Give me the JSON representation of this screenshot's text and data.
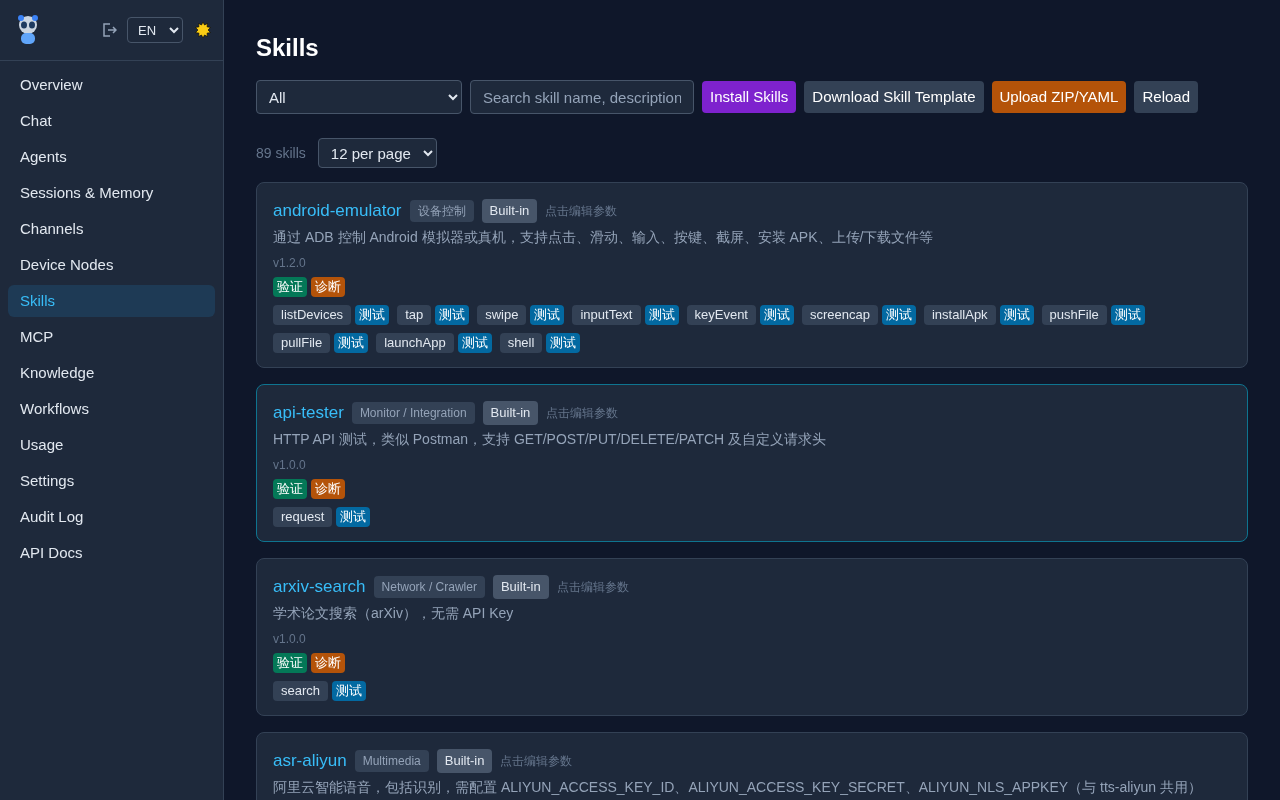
{
  "sidebar": {
    "language": "EN",
    "items": [
      {
        "label": "Overview",
        "selected": false
      },
      {
        "label": "Chat",
        "selected": false
      },
      {
        "label": "Agents",
        "selected": false
      },
      {
        "label": "Sessions & Memory",
        "selected": false
      },
      {
        "label": "Channels",
        "selected": false
      },
      {
        "label": "Device Nodes",
        "selected": false
      },
      {
        "label": "Skills",
        "selected": true
      },
      {
        "label": "MCP",
        "selected": false
      },
      {
        "label": "Knowledge",
        "selected": false
      },
      {
        "label": "Workflows",
        "selected": false
      },
      {
        "label": "Usage",
        "selected": false
      },
      {
        "label": "Settings",
        "selected": false
      },
      {
        "label": "Audit Log",
        "selected": false
      },
      {
        "label": "API Docs",
        "selected": false
      }
    ]
  },
  "page": {
    "title": "Skills",
    "filter": {
      "value": "All"
    },
    "search": {
      "placeholder": "Search skill name, description"
    },
    "buttons": [
      {
        "label": "Install Skills",
        "kind": "primary"
      },
      {
        "label": "Download Skill Template",
        "kind": "secondary"
      },
      {
        "label": "Upload ZIP/YAML",
        "kind": "warning"
      },
      {
        "label": "Reload",
        "kind": "secondary"
      }
    ],
    "count": "89 skills",
    "page_size": "12 per page"
  },
  "skills": [
    {
      "name": "android-emulator",
      "category": "设备控制",
      "source": "Built-in",
      "hint": "点击编辑参数",
      "highlighted": false,
      "description": "通过 ADB 控制 Android 模拟器或真机，支持点击、滑动、输入、按键、截屏、安装 APK、上传/下载文件等",
      "version": "v1.2.0",
      "badges": [
        {
          "label": "验证",
          "kind": "verify"
        },
        {
          "label": "诊断",
          "kind": "diagnose"
        }
      ],
      "tools": [
        {
          "name": "listDevices",
          "test": "测试"
        },
        {
          "name": "tap",
          "test": "测试"
        },
        {
          "name": "swipe",
          "test": "测试"
        },
        {
          "name": "inputText",
          "test": "测试"
        },
        {
          "name": "keyEvent",
          "test": "测试"
        },
        {
          "name": "screencap",
          "test": "测试"
        },
        {
          "name": "installApk",
          "test": "测试"
        },
        {
          "name": "pushFile",
          "test": "测试"
        },
        {
          "name": "pullFile",
          "test": "测试"
        },
        {
          "name": "launchApp",
          "test": "测试"
        },
        {
          "name": "shell",
          "test": "测试"
        }
      ]
    },
    {
      "name": "api-tester",
      "category": "Monitor / Integration",
      "source": "Built-in",
      "hint": "点击编辑参数",
      "highlighted": true,
      "description": "HTTP API 测试，类似 Postman，支持 GET/POST/PUT/DELETE/PATCH 及自定义请求头",
      "version": "v1.0.0",
      "badges": [
        {
          "label": "验证",
          "kind": "verify"
        },
        {
          "label": "诊断",
          "kind": "diagnose"
        }
      ],
      "tools": [
        {
          "name": "request",
          "test": "测试"
        }
      ]
    },
    {
      "name": "arxiv-search",
      "category": "Network / Crawler",
      "source": "Built-in",
      "hint": "点击编辑参数",
      "highlighted": false,
      "description": "学术论文搜索（arXiv），无需 API Key",
      "version": "v1.0.0",
      "badges": [
        {
          "label": "验证",
          "kind": "verify"
        },
        {
          "label": "诊断",
          "kind": "diagnose"
        }
      ],
      "tools": [
        {
          "name": "search",
          "test": "测试"
        }
      ]
    },
    {
      "name": "asr-aliyun",
      "category": "Multimedia",
      "source": "Built-in",
      "hint": "点击编辑参数",
      "highlighted": false,
      "description": "阿里云智能语音，包括识别，需配置 ALIYUN_ACCESS_KEY_ID、ALIYUN_ACCESS_KEY_SECRET、ALIYUN_NLS_APPKEY（与 tts-aliyun 共用）"
    }
  ]
}
